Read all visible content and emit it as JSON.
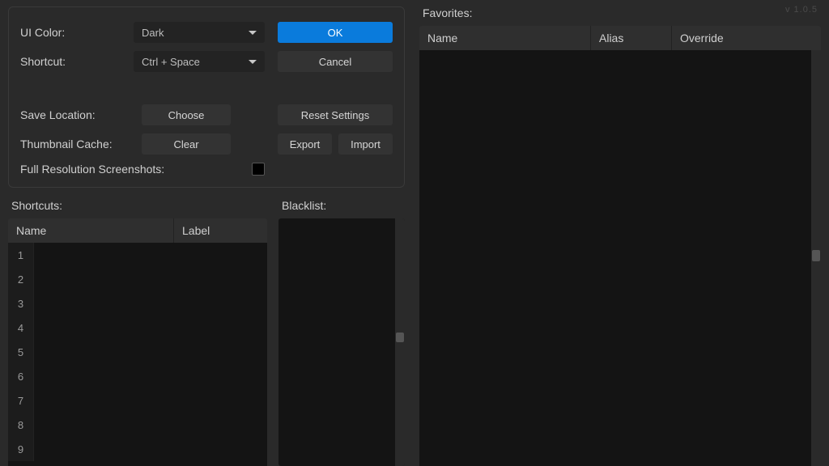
{
  "version": "v 1.0.5",
  "settings": {
    "ui_color_label": "UI Color:",
    "ui_color_value": "Dark",
    "shortcut_label": "Shortcut:",
    "shortcut_value": "Ctrl + Space",
    "save_location_label": "Save Location:",
    "choose_label": "Choose",
    "thumb_cache_label": "Thumbnail Cache:",
    "clear_label": "Clear",
    "full_res_label": "Full Resolution Screenshots:"
  },
  "actions": {
    "ok": "OK",
    "cancel": "Cancel",
    "reset": "Reset Settings",
    "export": "Export",
    "import": "Import"
  },
  "shortcuts": {
    "title": "Shortcuts:",
    "col_name": "Name",
    "col_label": "Label",
    "rows": [
      {
        "n": "1",
        "name": "",
        "label": ""
      },
      {
        "n": "2",
        "name": "",
        "label": ""
      },
      {
        "n": "3",
        "name": "",
        "label": ""
      },
      {
        "n": "4",
        "name": "",
        "label": ""
      },
      {
        "n": "5",
        "name": "",
        "label": ""
      },
      {
        "n": "6",
        "name": "",
        "label": ""
      },
      {
        "n": "7",
        "name": "",
        "label": ""
      },
      {
        "n": "8",
        "name": "",
        "label": ""
      },
      {
        "n": "9",
        "name": "",
        "label": ""
      }
    ]
  },
  "blacklist": {
    "title": "Blacklist:"
  },
  "favorites": {
    "title": "Favorites:",
    "col_name": "Name",
    "col_alias": "Alias",
    "col_override": "Override"
  }
}
